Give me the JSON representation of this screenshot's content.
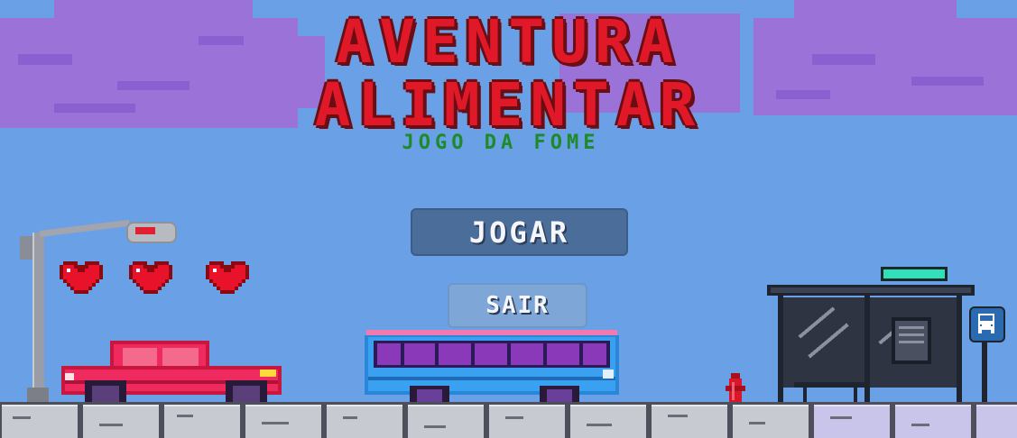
{
  "game": {
    "title_line1": "AVENTURA",
    "title_line2": "ALIMENTAR",
    "subtitle": "JOGO DA FOME"
  },
  "menu": {
    "play_label": "JOGAR",
    "exit_label": "SAIR"
  },
  "hud": {
    "lives": 3
  },
  "colors": {
    "sky": "#6aa0e6",
    "cloud": "#9b72d8",
    "title": "#e01828",
    "subtitle": "#1e8a2a",
    "heart": "#e8122a",
    "car": "#ee2a5e",
    "bus": "#3aa0f0",
    "shelter_sign": "#2fe0b8"
  }
}
